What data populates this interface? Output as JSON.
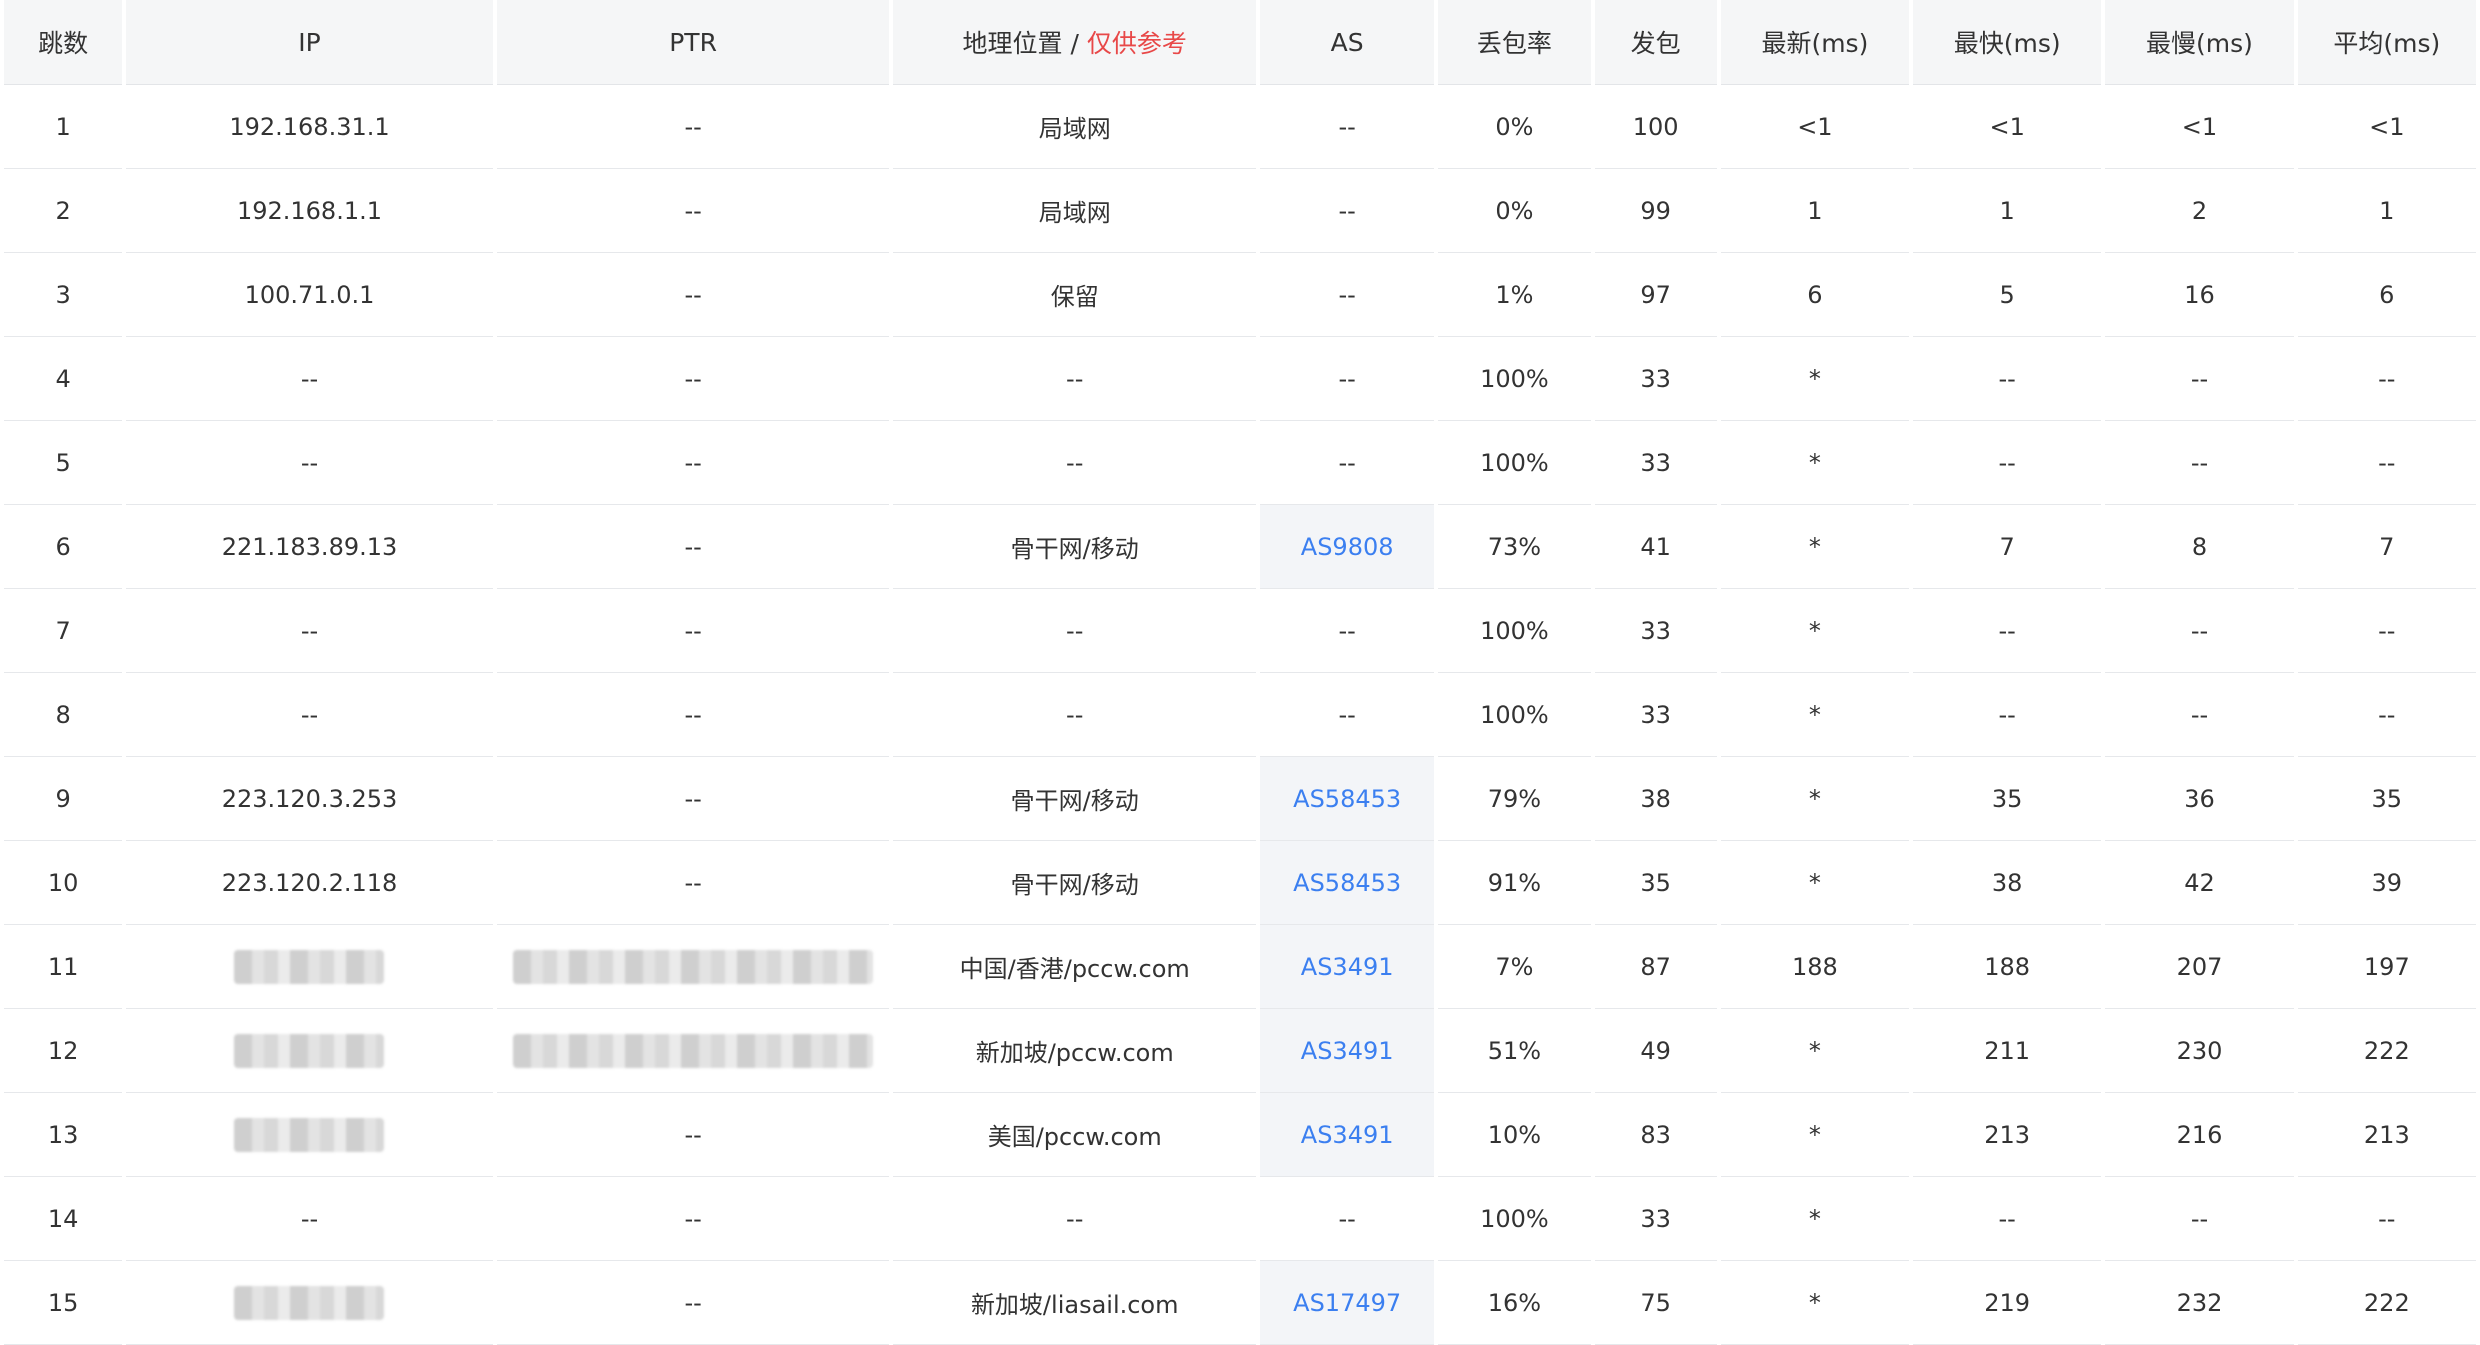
{
  "headers": {
    "hop": "跳数",
    "ip": "IP",
    "ptr": "PTR",
    "geo": "地理位置",
    "geo_sep": " / ",
    "geo_note": "仅供参考",
    "as": "AS",
    "loss": "丢包率",
    "sent": "发包",
    "last": "最新(ms)",
    "best": "最快(ms)",
    "worst": "最慢(ms)",
    "avg": "平均(ms)"
  },
  "colors": {
    "accent_link": "#3b7ff0",
    "warn": "#e84848"
  },
  "rows": [
    {
      "hop": "1",
      "ip": "192.168.31.1",
      "ptr": "--",
      "geo": "局域网",
      "as": "--",
      "loss": "0%",
      "sent": "100",
      "last": "<1",
      "best": "<1",
      "worst": "<1",
      "avg": "<1"
    },
    {
      "hop": "2",
      "ip": "192.168.1.1",
      "ptr": "--",
      "geo": "局域网",
      "as": "--",
      "loss": "0%",
      "sent": "99",
      "last": "1",
      "best": "1",
      "worst": "2",
      "avg": "1"
    },
    {
      "hop": "3",
      "ip": "100.71.0.1",
      "ptr": "--",
      "geo": "保留",
      "as": "--",
      "loss": "1%",
      "sent": "97",
      "last": "6",
      "best": "5",
      "worst": "16",
      "avg": "6"
    },
    {
      "hop": "4",
      "ip": "--",
      "ptr": "--",
      "geo": "--",
      "as": "--",
      "loss": "100%",
      "sent": "33",
      "last": "*",
      "best": "--",
      "worst": "--",
      "avg": "--"
    },
    {
      "hop": "5",
      "ip": "--",
      "ptr": "--",
      "geo": "--",
      "as": "--",
      "loss": "100%",
      "sent": "33",
      "last": "*",
      "best": "--",
      "worst": "--",
      "avg": "--"
    },
    {
      "hop": "6",
      "ip": "221.183.89.13",
      "ptr": "--",
      "geo": "骨干网/移动",
      "as": "AS9808",
      "loss": "73%",
      "sent": "41",
      "last": "*",
      "best": "7",
      "worst": "8",
      "avg": "7"
    },
    {
      "hop": "7",
      "ip": "--",
      "ptr": "--",
      "geo": "--",
      "as": "--",
      "loss": "100%",
      "sent": "33",
      "last": "*",
      "best": "--",
      "worst": "--",
      "avg": "--"
    },
    {
      "hop": "8",
      "ip": "--",
      "ptr": "--",
      "geo": "--",
      "as": "--",
      "loss": "100%",
      "sent": "33",
      "last": "*",
      "best": "--",
      "worst": "--",
      "avg": "--"
    },
    {
      "hop": "9",
      "ip": "223.120.3.253",
      "ptr": "--",
      "geo": "骨干网/移动",
      "as": "AS58453",
      "loss": "79%",
      "sent": "38",
      "last": "*",
      "best": "35",
      "worst": "36",
      "avg": "35"
    },
    {
      "hop": "10",
      "ip": "223.120.2.118",
      "ptr": "--",
      "geo": "骨干网/移动",
      "as": "AS58453",
      "loss": "91%",
      "sent": "35",
      "last": "*",
      "best": "38",
      "worst": "42",
      "avg": "39"
    },
    {
      "hop": "11",
      "ip": "",
      "ptr": "",
      "ip_blurred": true,
      "ptr_blurred": true,
      "geo": "中国/香港/pccw.com",
      "as": "AS3491",
      "loss": "7%",
      "sent": "87",
      "last": "188",
      "best": "188",
      "worst": "207",
      "avg": "197"
    },
    {
      "hop": "12",
      "ip": "",
      "ptr": "",
      "ip_blurred": true,
      "ptr_blurred": true,
      "geo": "新加坡/pccw.com",
      "as": "AS3491",
      "loss": "51%",
      "sent": "49",
      "last": "*",
      "best": "211",
      "worst": "230",
      "avg": "222"
    },
    {
      "hop": "13",
      "ip": "",
      "ptr": "--",
      "ip_blurred": true,
      "geo": "美国/pccw.com",
      "as": "AS3491",
      "loss": "10%",
      "sent": "83",
      "last": "*",
      "best": "213",
      "worst": "216",
      "avg": "213"
    },
    {
      "hop": "14",
      "ip": "--",
      "ptr": "--",
      "geo": "--",
      "as": "--",
      "loss": "100%",
      "sent": "33",
      "last": "*",
      "best": "--",
      "worst": "--",
      "avg": "--"
    },
    {
      "hop": "15",
      "ip": "",
      "ptr": "--",
      "ip_blurred": true,
      "geo": "新加坡/liasail.com",
      "as": "AS17497",
      "loss": "16%",
      "sent": "75",
      "last": "*",
      "best": "219",
      "worst": "232",
      "avg": "222"
    }
  ]
}
